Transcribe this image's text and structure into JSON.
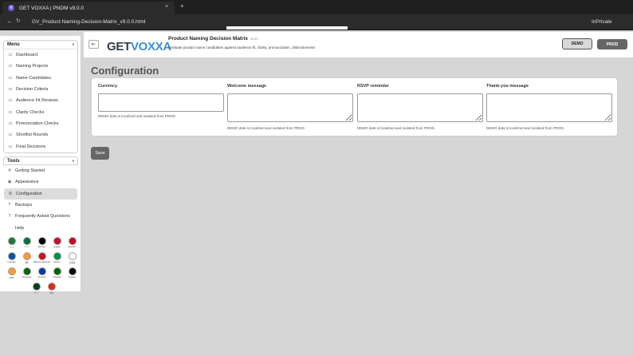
{
  "browser": {
    "tab_title": "GET VOXXA | PNDM v9.0.0",
    "favicon_letter": "V",
    "close_glyph": "×",
    "new_tab_glyph": "+",
    "back_glyph": "←",
    "reload_glyph": "↻",
    "url": "GV_Product-Naming-Decision-Matrix_v9.0.0.html",
    "mode": "InPrivate"
  },
  "header": {
    "menu_glyph": "⇤",
    "logo_get": "GET",
    "logo_voxxa": "VOXXA",
    "title": "Product Naming Decision Matrix",
    "version": "v9.0.0",
    "subtitle": "Evaluate product name candidates against audience fit, clarity, pronunciation, distinctiveness",
    "env_demo": "DEMO",
    "env_prod": "PROD"
  },
  "sidebar": {
    "menu_title": "Menu",
    "menu_items": [
      {
        "label": "Dashboard",
        "icon": "grid-icon"
      },
      {
        "label": "Naming Projects",
        "icon": "folder-icon"
      },
      {
        "label": "Name Candidates",
        "icon": "list-icon"
      },
      {
        "label": "Decision Criteria",
        "icon": "checklist-icon"
      },
      {
        "label": "Audience Fit Reviews",
        "icon": "users-icon"
      },
      {
        "label": "Clarity Checks",
        "icon": "check-icon"
      },
      {
        "label": "Pronunciation Checks",
        "icon": "mic-icon"
      },
      {
        "label": "Shortlist Rounds",
        "icon": "star-icon"
      },
      {
        "label": "Final Decisions",
        "icon": "flag-icon"
      }
    ],
    "tools_title": "Tools",
    "tool_items": [
      {
        "label": "Getting Started",
        "icon": "rocket-icon",
        "glyph": "⁜"
      },
      {
        "label": "Appearance",
        "icon": "palette-icon",
        "glyph": "◉"
      },
      {
        "label": "Configuration",
        "icon": "gear-icon",
        "glyph": "⚙"
      },
      {
        "label": "Backups",
        "icon": "upload-icon",
        "glyph": "⤒"
      },
      {
        "label": "Frequently Asked Questions",
        "icon": "question-icon",
        "glyph": "?"
      },
      {
        "label": "Help",
        "icon": "help-icon",
        "glyph": ""
      }
    ],
    "languages": [
      {
        "label": "عربي",
        "color": "#1e7a3a"
      },
      {
        "label": "বাংলা",
        "color": "#0a6e3f"
      },
      {
        "label": "Deutsch",
        "color": "#000000"
      },
      {
        "label": "English",
        "color": "#c8102e"
      },
      {
        "label": "Español",
        "color": "#c60b1e"
      },
      {
        "label": "Français",
        "color": "#0055a4"
      },
      {
        "label": "हिंदी",
        "color": "#ff9933"
      },
      {
        "label": "Bahasa Indonesia",
        "color": "#ce1126"
      },
      {
        "label": "Italiano",
        "color": "#009246"
      },
      {
        "label": "日本語",
        "color": "#ffffff"
      },
      {
        "label": "मराठी",
        "color": "#ff9933"
      },
      {
        "label": "Português",
        "color": "#006600"
      },
      {
        "label": "Русский",
        "color": "#0039a6"
      },
      {
        "label": "Kiswahili",
        "color": "#006600"
      },
      {
        "label": "Tagalog",
        "color": "#000000"
      },
      {
        "label": "اردو",
        "color": "#01411c"
      },
      {
        "label": "中文",
        "color": "#de2910"
      }
    ]
  },
  "main": {
    "title": "Configuration",
    "fields": [
      {
        "label": "Currency",
        "value": "",
        "note": "DEMO data is localized and isolated from PROD."
      },
      {
        "label": "Welcome message",
        "value": "",
        "note": "DEMO data is localized and isolated from PROD."
      },
      {
        "label": "RSVP reminder",
        "value": "",
        "note": "DEMO data is localized and isolated from PROD."
      },
      {
        "label": "Thank-you message",
        "value": "",
        "note": "DEMO data is localized and isolated from PROD."
      }
    ],
    "save_label": "Save"
  }
}
